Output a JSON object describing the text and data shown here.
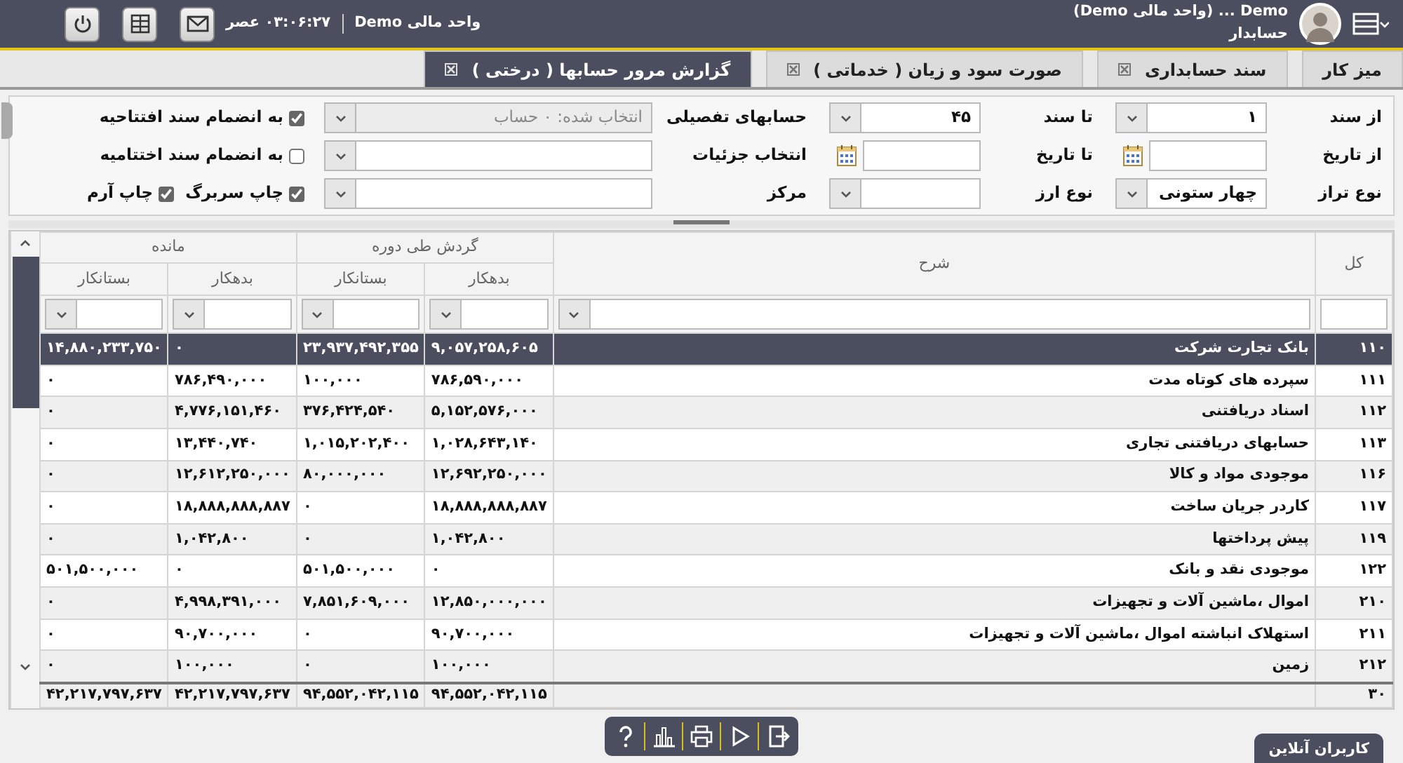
{
  "header": {
    "user_name": "Demo ... (واحد مالی Demo)",
    "user_role": "حسابدار",
    "unit": "واحد مالی Demo",
    "time": "۰۳:۰۶:۲۷ عصر"
  },
  "tabs": [
    {
      "label": "میز کار",
      "closable": false,
      "selected": false
    },
    {
      "label": "سند حسابداری",
      "closable": true,
      "selected": false
    },
    {
      "label": "صورت سود و زیان ( خدماتی )",
      "closable": true,
      "selected": false
    },
    {
      "label": "گزارش مرور حسابها ( درختی )",
      "closable": true,
      "selected": true
    }
  ],
  "filters": [
    {
      "label": "از سند",
      "kind": "select",
      "value": "۱",
      "disabled": false
    },
    {
      "label": "تا سند",
      "kind": "select",
      "value": "۴۵",
      "disabled": false
    },
    {
      "label": "حسابهای تفصیلی",
      "kind": "select",
      "value": "انتخاب شده: ۰ حساب",
      "disabled": true
    },
    {
      "label": "از تاریخ",
      "kind": "date",
      "disabled": false
    },
    {
      "label": "تا تاریخ",
      "kind": "date",
      "disabled": false
    },
    {
      "label": "انتخاب جزئیات",
      "kind": "select",
      "disabled": false
    },
    {
      "label": "نوع تراز",
      "kind": "select",
      "value": "چهار ستونی",
      "disabled": false
    },
    {
      "label": "نوع ارز",
      "kind": "select",
      "disabled": false
    },
    {
      "label": "مرکز",
      "kind": "select",
      "disabled": false
    }
  ],
  "options": [
    [
      {
        "label": "به انضمام سند افتتاحیه",
        "checked": true
      }
    ],
    [
      {
        "label": "به انضمام سند اختتامیه",
        "checked": false
      }
    ],
    [
      {
        "label": "چاپ سربرگ",
        "checked": true
      },
      {
        "label": "چاپ آرم",
        "checked": true
      }
    ]
  ],
  "table": {
    "columns": [
      "کل",
      "شرح"
    ],
    "groups": [
      {
        "label": "گردش طی دوره",
        "columns": [
          "بدهکار",
          "بستانکار"
        ]
      },
      {
        "label": "مانده",
        "columns": [
          "بدهکار",
          "بستانکار"
        ]
      }
    ],
    "rows": [
      {
        "cells": [
          "۱۱۰",
          "بانک تجارت شرکت",
          "۹,۰۵۷,۲۵۸,۶۰۵",
          "۲۳,۹۳۷,۴۹۲,۳۵۵",
          "۰",
          "۱۴,۸۸۰,۲۳۳,۷۵۰"
        ],
        "selected": true
      },
      {
        "cells": [
          "۱۱۱",
          "سپرده های کوتاه مدت",
          "۷۸۶,۵۹۰,۰۰۰",
          "۱۰۰,۰۰۰",
          "۷۸۶,۴۹۰,۰۰۰",
          "۰"
        ],
        "selected": false
      },
      {
        "cells": [
          "۱۱۲",
          "اسناد دریافتنی",
          "۵,۱۵۲,۵۷۶,۰۰۰",
          "۳۷۶,۴۲۴,۵۴۰",
          "۴,۷۷۶,۱۵۱,۴۶۰",
          "۰"
        ],
        "selected": false
      },
      {
        "cells": [
          "۱۱۳",
          "حسابهای دریافتنی تجاری",
          "۱,۰۲۸,۶۴۳,۱۴۰",
          "۱,۰۱۵,۲۰۲,۴۰۰",
          "۱۳,۴۴۰,۷۴۰",
          "۰"
        ],
        "selected": false
      },
      {
        "cells": [
          "۱۱۶",
          "موجودی مواد و کالا",
          "۱۲,۶۹۲,۲۵۰,۰۰۰",
          "۸۰,۰۰۰,۰۰۰",
          "۱۲,۶۱۲,۲۵۰,۰۰۰",
          "۰"
        ],
        "selected": false
      },
      {
        "cells": [
          "۱۱۷",
          "کاردر جریان ساخت",
          "۱۸,۸۸۸,۸۸۸,۸۸۷",
          "۰",
          "۱۸,۸۸۸,۸۸۸,۸۸۷",
          "۰"
        ],
        "selected": false
      },
      {
        "cells": [
          "۱۱۹",
          "پیش پرداختها",
          "۱,۰۴۲,۸۰۰",
          "۰",
          "۱,۰۴۲,۸۰۰",
          "۰"
        ],
        "selected": false
      },
      {
        "cells": [
          "۱۲۲",
          "موجودی نقد و بانک",
          "۰",
          "۵۰۱,۵۰۰,۰۰۰",
          "۰",
          "۵۰۱,۵۰۰,۰۰۰"
        ],
        "selected": false
      },
      {
        "cells": [
          "۲۱۰",
          "اموال ،ماشین آلات و تجهیزات",
          "۱۲,۸۵۰,۰۰۰,۰۰۰",
          "۷,۸۵۱,۶۰۹,۰۰۰",
          "۴,۹۹۸,۳۹۱,۰۰۰",
          "۰"
        ],
        "selected": false
      },
      {
        "cells": [
          "۲۱۱",
          "استهلاک انباشته اموال ،ماشین آلات و تجهیزات",
          "۹۰,۷۰۰,۰۰۰",
          "۰",
          "۹۰,۷۰۰,۰۰۰",
          "۰"
        ],
        "selected": false
      },
      {
        "cells": [
          "۲۱۲",
          "زمین",
          "۱۰۰,۰۰۰",
          "۰",
          "۱۰۰,۰۰۰",
          "۰"
        ],
        "selected": false
      }
    ],
    "footer": {
      "count": "۳۰",
      "totals": [
        "۹۴,۵۵۲,۰۴۲,۱۱۵",
        "۹۴,۵۵۲,۰۴۲,۱۱۵",
        "۴۲,۲۱۷,۷۹۷,۶۳۷",
        "۴۲,۲۱۷,۷۹۷,۶۳۷"
      ]
    }
  },
  "online_users": "کاربران آنلاین"
}
